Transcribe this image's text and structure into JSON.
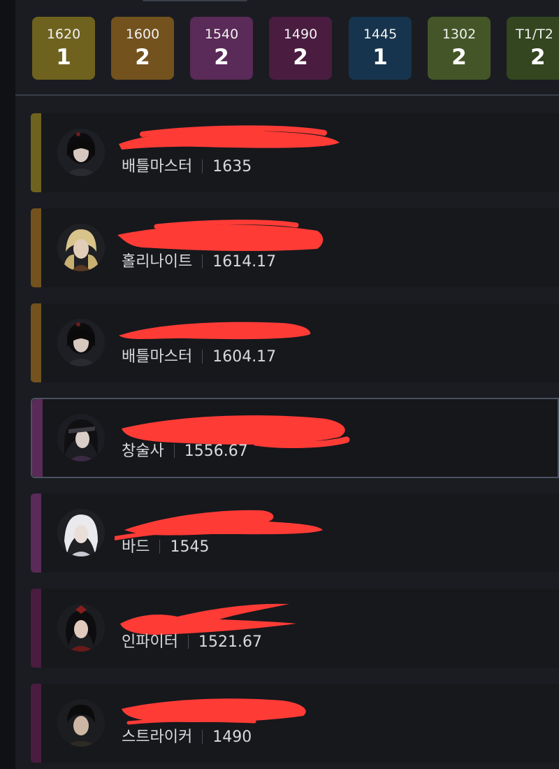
{
  "filters": [
    {
      "level": "1620",
      "count": "1",
      "color": "#6f621e"
    },
    {
      "level": "1600",
      "count": "2",
      "color": "#73521e"
    },
    {
      "level": "1540",
      "count": "2",
      "color": "#5a2a58"
    },
    {
      "level": "1490",
      "count": "2",
      "color": "#4a1c40"
    },
    {
      "level": "1445",
      "count": "1",
      "color": "#16344d"
    },
    {
      "level": "1302",
      "count": "2",
      "color": "#445628"
    },
    {
      "level": "T1/T2",
      "count": "2",
      "color": "#33461f"
    }
  ],
  "players": [
    {
      "class": "배틀마스터",
      "item_level": "1635",
      "bar_color": "#6f621e",
      "avatar": "battlemaster-portrait"
    },
    {
      "class": "홀리나이트",
      "item_level": "1614.17",
      "bar_color": "#73521e",
      "avatar": "holyknight-portrait"
    },
    {
      "class": "배틀마스터",
      "item_level": "1604.17",
      "bar_color": "#73521e",
      "avatar": "battlemaster-portrait"
    },
    {
      "class": "창술사",
      "item_level": "1556.67",
      "bar_color": "#5a2a58",
      "avatar": "lancemaster-portrait",
      "selected": true
    },
    {
      "class": "바드",
      "item_level": "1545",
      "bar_color": "#5a2a58",
      "avatar": "bard-portrait"
    },
    {
      "class": "인파이터",
      "item_level": "1521.67",
      "bar_color": "#4a1c40",
      "avatar": "infighter-portrait"
    },
    {
      "class": "스트라이커",
      "item_level": "1490",
      "bar_color": "#4a1c40",
      "avatar": "striker-portrait"
    }
  ],
  "redaction_color": "#ff3b36"
}
